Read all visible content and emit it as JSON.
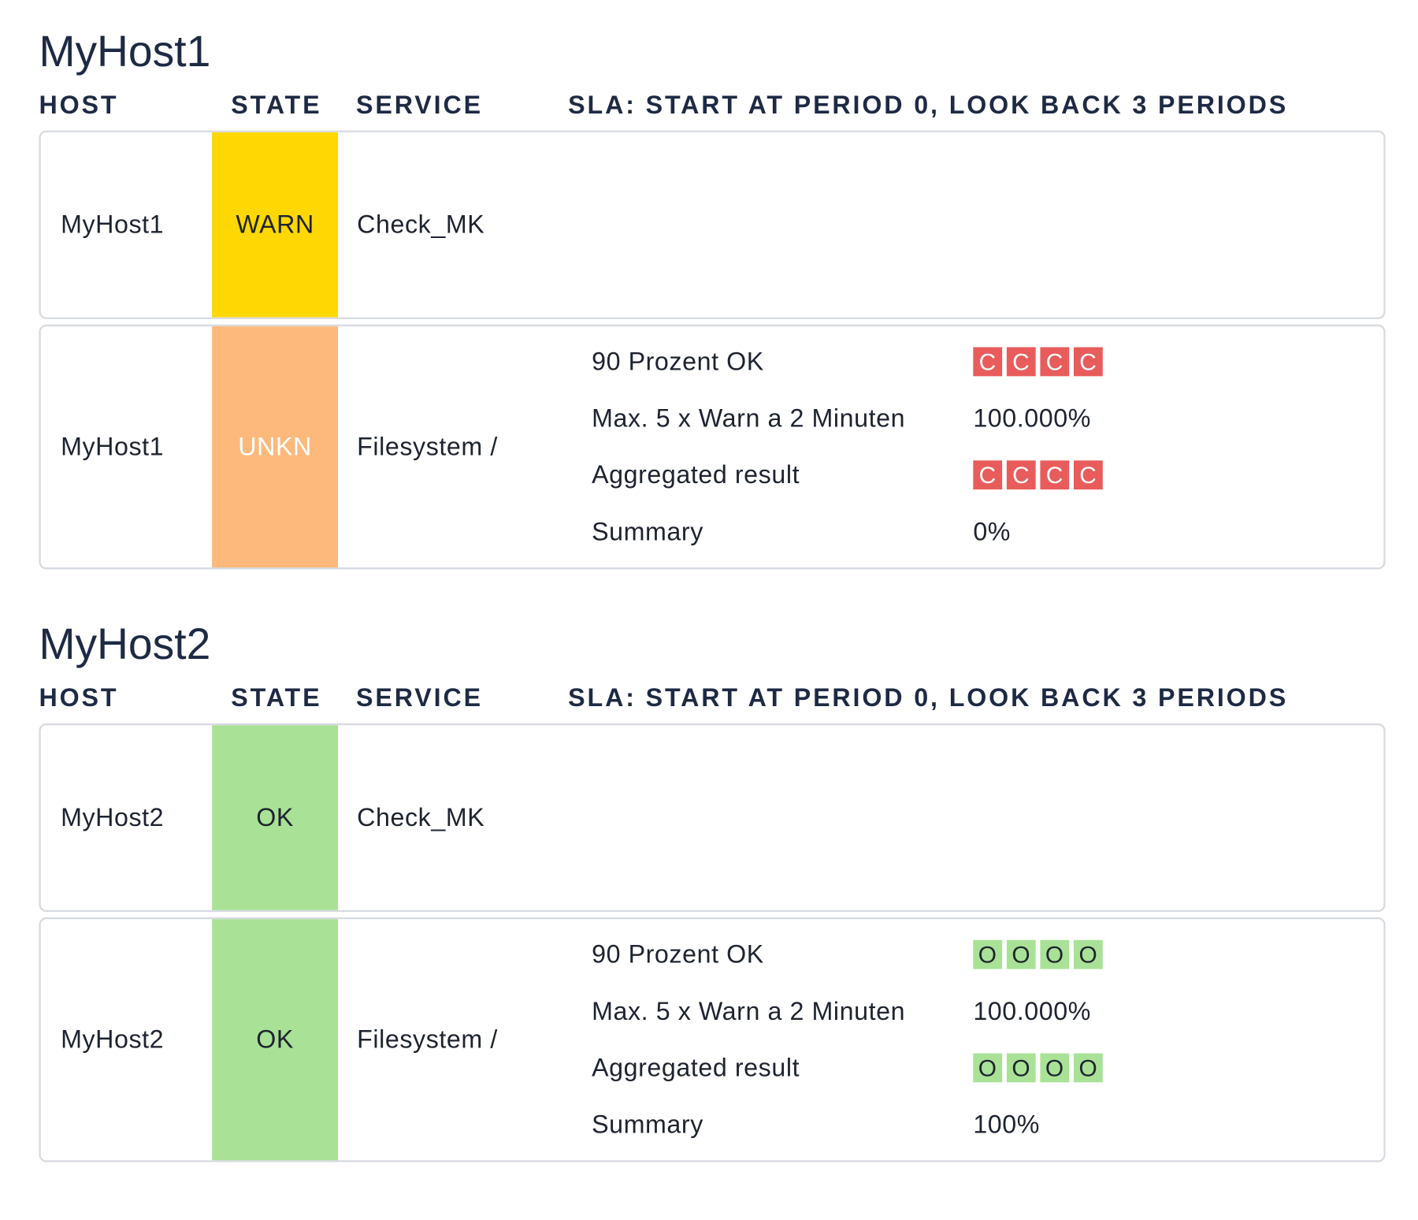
{
  "columns": {
    "host": "HOST",
    "state": "STATE",
    "service": "SERVICE",
    "sla": "SLA: START AT PERIOD 0, LOOK BACK 3 PERIODS"
  },
  "state_colors": {
    "WARN": "#ffd703",
    "UNKN": "#fdb97c",
    "OK": "#a9e296",
    "crit_box": "#e85c5c"
  },
  "hosts": [
    {
      "title": "MyHost1",
      "rows": [
        {
          "host": "MyHost1",
          "state": "WARN",
          "service": "Check_MK"
        },
        {
          "host": "MyHost1",
          "state": "UNKN",
          "service": "Filesystem /",
          "sla": [
            {
              "label": "90 Prozent OK",
              "boxes": [
                "C",
                "C",
                "C",
                "C"
              ]
            },
            {
              "label": "Max. 5 x Warn a 2 Minuten",
              "value": "100.000%"
            },
            {
              "label": "Aggregated result",
              "boxes": [
                "C",
                "C",
                "C",
                "C"
              ]
            },
            {
              "label": "Summary",
              "value": "0%"
            }
          ]
        }
      ]
    },
    {
      "title": "MyHost2",
      "rows": [
        {
          "host": "MyHost2",
          "state": "OK",
          "service": "Check_MK"
        },
        {
          "host": "MyHost2",
          "state": "OK",
          "service": "Filesystem /",
          "sla": [
            {
              "label": "90 Prozent OK",
              "boxes": [
                "O",
                "O",
                "O",
                "O"
              ]
            },
            {
              "label": "Max. 5 x Warn a 2 Minuten",
              "value": "100.000%"
            },
            {
              "label": "Aggregated result",
              "boxes": [
                "O",
                "O",
                "O",
                "O"
              ]
            },
            {
              "label": "Summary",
              "value": "100%"
            }
          ]
        }
      ]
    }
  ]
}
